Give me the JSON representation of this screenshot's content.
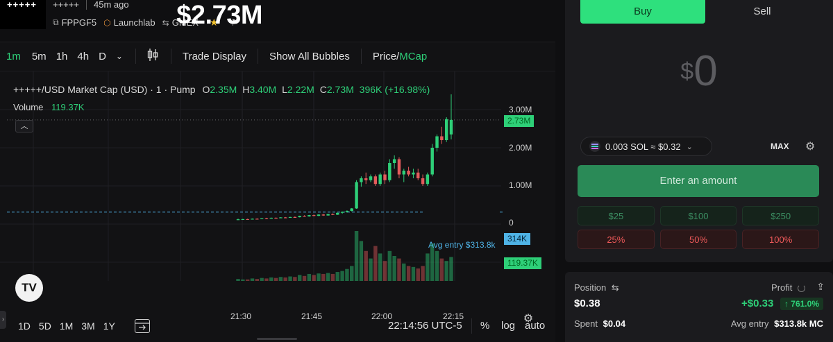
{
  "header": {
    "logo_text": "+++++",
    "token_name": "+++++",
    "time_ago": "45m ago",
    "ticker": "FPPGF5",
    "platform": "Launchlab",
    "exchange": "GMEX",
    "market_cap": "$2.73M"
  },
  "toolbar": {
    "intervals": [
      "1m",
      "5m",
      "1h",
      "4h",
      "D"
    ],
    "trade_display": "Trade Display",
    "show_all_bubbles": "Show All Bubbles",
    "price_label": "Price",
    "slash": "/",
    "mcap_label": "MCap"
  },
  "legend": {
    "symbol": "+++++/USD Market Cap (USD) · 1 · Pump",
    "o_label": "O",
    "o_value": "2.35M",
    "h_label": "H",
    "h_value": "3.40M",
    "l_label": "L",
    "l_value": "2.22M",
    "c_label": "C",
    "c_value": "2.73M",
    "change": "396K (+16.98%)",
    "volume_label": "Volume",
    "volume_value": "119.37K"
  },
  "price_axis": {
    "ticks": [
      "3.00M",
      "2.00M",
      "1.00M",
      "0"
    ],
    "last_price_tag": "2.73M",
    "avg_entry_tag": "314K",
    "volume_tag": "119.37K"
  },
  "avg_entry_label": "Avg entry $313.8k",
  "time_axis": [
    "21:30",
    "21:45",
    "22:00",
    "22:15"
  ],
  "bottom_bar": {
    "ranges": [
      "1D",
      "5D",
      "1M",
      "3M",
      "1Y"
    ],
    "clock": "22:14:56 UTC-5",
    "percent": "%",
    "log": "log",
    "auto": "auto"
  },
  "trade": {
    "buy": "Buy",
    "sell": "Sell",
    "amount_currency": "$",
    "amount_value": "0",
    "sol_conversion": "0.003 SOL ≈ $0.32",
    "max": "MAX",
    "enter_amount": "Enter an amount",
    "quick_buy": [
      "$25",
      "$100",
      "$250"
    ],
    "quick_sell": [
      "25%",
      "50%",
      "100%"
    ]
  },
  "position": {
    "position_label": "Position",
    "profit_label": "Profit",
    "position_value": "$0.38",
    "profit_value": "+$0.33",
    "profit_pct": "↑ 761.0%",
    "spent_label": "Spent",
    "spent_value": "$0.04",
    "avg_entry_label": "Avg entry",
    "avg_entry_value": "$313.8k MC"
  },
  "colors": {
    "up": "#2ecf78",
    "down": "#e35b5b",
    "buy_button": "#2ee07d",
    "avg_entry_line": "#4fb3e6"
  },
  "chart_data": {
    "type": "candlestick",
    "y_range": [
      0,
      3400000
    ],
    "x_range": [
      "21:30",
      "22:15"
    ],
    "candles": [
      {
        "o": 120000,
        "h": 140000,
        "l": 110000,
        "c": 125000,
        "v": 4
      },
      {
        "o": 125000,
        "h": 135000,
        "l": 118000,
        "c": 130000,
        "v": 3
      },
      {
        "o": 130000,
        "h": 140000,
        "l": 122000,
        "c": 128000,
        "v": 3
      },
      {
        "o": 128000,
        "h": 145000,
        "l": 125000,
        "c": 140000,
        "v": 5
      },
      {
        "o": 140000,
        "h": 150000,
        "l": 130000,
        "c": 138000,
        "v": 4
      },
      {
        "o": 138000,
        "h": 155000,
        "l": 135000,
        "c": 150000,
        "v": 6
      },
      {
        "o": 150000,
        "h": 165000,
        "l": 140000,
        "c": 145000,
        "v": 5
      },
      {
        "o": 145000,
        "h": 170000,
        "l": 140000,
        "c": 165000,
        "v": 7
      },
      {
        "o": 165000,
        "h": 175000,
        "l": 155000,
        "c": 160000,
        "v": 6
      },
      {
        "o": 160000,
        "h": 180000,
        "l": 155000,
        "c": 175000,
        "v": 8
      },
      {
        "o": 175000,
        "h": 185000,
        "l": 165000,
        "c": 170000,
        "v": 7
      },
      {
        "o": 170000,
        "h": 190000,
        "l": 165000,
        "c": 185000,
        "v": 9
      },
      {
        "o": 185000,
        "h": 200000,
        "l": 175000,
        "c": 180000,
        "v": 8
      },
      {
        "o": 180000,
        "h": 220000,
        "l": 175000,
        "c": 215000,
        "v": 12
      },
      {
        "o": 215000,
        "h": 230000,
        "l": 190000,
        "c": 200000,
        "v": 10
      },
      {
        "o": 200000,
        "h": 240000,
        "l": 195000,
        "c": 235000,
        "v": 14
      },
      {
        "o": 235000,
        "h": 250000,
        "l": 205000,
        "c": 215000,
        "v": 12
      },
      {
        "o": 215000,
        "h": 255000,
        "l": 210000,
        "c": 250000,
        "v": 15
      },
      {
        "o": 250000,
        "h": 265000,
        "l": 215000,
        "c": 225000,
        "v": 14
      },
      {
        "o": 225000,
        "h": 270000,
        "l": 220000,
        "c": 262000,
        "v": 16
      },
      {
        "o": 262000,
        "h": 280000,
        "l": 235000,
        "c": 245000,
        "v": 14
      },
      {
        "o": 245000,
        "h": 300000,
        "l": 240000,
        "c": 295000,
        "v": 18
      },
      {
        "o": 295000,
        "h": 330000,
        "l": 270000,
        "c": 320000,
        "v": 20
      },
      {
        "o": 320000,
        "h": 360000,
        "l": 300000,
        "c": 345000,
        "v": 24
      },
      {
        "o": 345000,
        "h": 420000,
        "l": 330000,
        "c": 410000,
        "v": 30
      },
      {
        "o": 410000,
        "h": 1150000,
        "l": 400000,
        "c": 1100000,
        "v": 100
      },
      {
        "o": 1100000,
        "h": 1250000,
        "l": 980000,
        "c": 1200000,
        "v": 80
      },
      {
        "o": 1200000,
        "h": 1350000,
        "l": 1050000,
        "c": 1150000,
        "v": 60
      },
      {
        "o": 1150000,
        "h": 1300000,
        "l": 1100000,
        "c": 1250000,
        "v": 45
      },
      {
        "o": 1250000,
        "h": 1300000,
        "l": 1000000,
        "c": 1050000,
        "v": 70
      },
      {
        "o": 1050000,
        "h": 1350000,
        "l": 1000000,
        "c": 1300000,
        "v": 55
      },
      {
        "o": 1300000,
        "h": 1400000,
        "l": 1050000,
        "c": 1150000,
        "v": 40
      },
      {
        "o": 1150000,
        "h": 1700000,
        "l": 1100000,
        "c": 1600000,
        "v": 60
      },
      {
        "o": 1600000,
        "h": 1800000,
        "l": 1450000,
        "c": 1700000,
        "v": 50
      },
      {
        "o": 1700000,
        "h": 1750000,
        "l": 1200000,
        "c": 1300000,
        "v": 45
      },
      {
        "o": 1300000,
        "h": 1450000,
        "l": 1100000,
        "c": 1400000,
        "v": 35
      },
      {
        "o": 1400000,
        "h": 1500000,
        "l": 1250000,
        "c": 1300000,
        "v": 30
      },
      {
        "o": 1300000,
        "h": 1450000,
        "l": 1200000,
        "c": 1350000,
        "v": 28
      },
      {
        "o": 1350000,
        "h": 1450000,
        "l": 1150000,
        "c": 1200000,
        "v": 25
      },
      {
        "o": 1200000,
        "h": 1300000,
        "l": 1000000,
        "c": 1050000,
        "v": 30
      },
      {
        "o": 1050000,
        "h": 1350000,
        "l": 1000000,
        "c": 1300000,
        "v": 55
      },
      {
        "o": 1300000,
        "h": 2100000,
        "l": 1250000,
        "c": 2000000,
        "v": 75
      },
      {
        "o": 2000000,
        "h": 2350000,
        "l": 1900000,
        "c": 2300000,
        "v": 60
      },
      {
        "o": 2300000,
        "h": 2550000,
        "l": 2100000,
        "c": 2200000,
        "v": 45
      },
      {
        "o": 2200000,
        "h": 2800000,
        "l": 2150000,
        "c": 2750000,
        "v": 40
      },
      {
        "o": 2350000,
        "h": 3400000,
        "l": 2220000,
        "c": 2730000,
        "v": 48
      }
    ]
  }
}
